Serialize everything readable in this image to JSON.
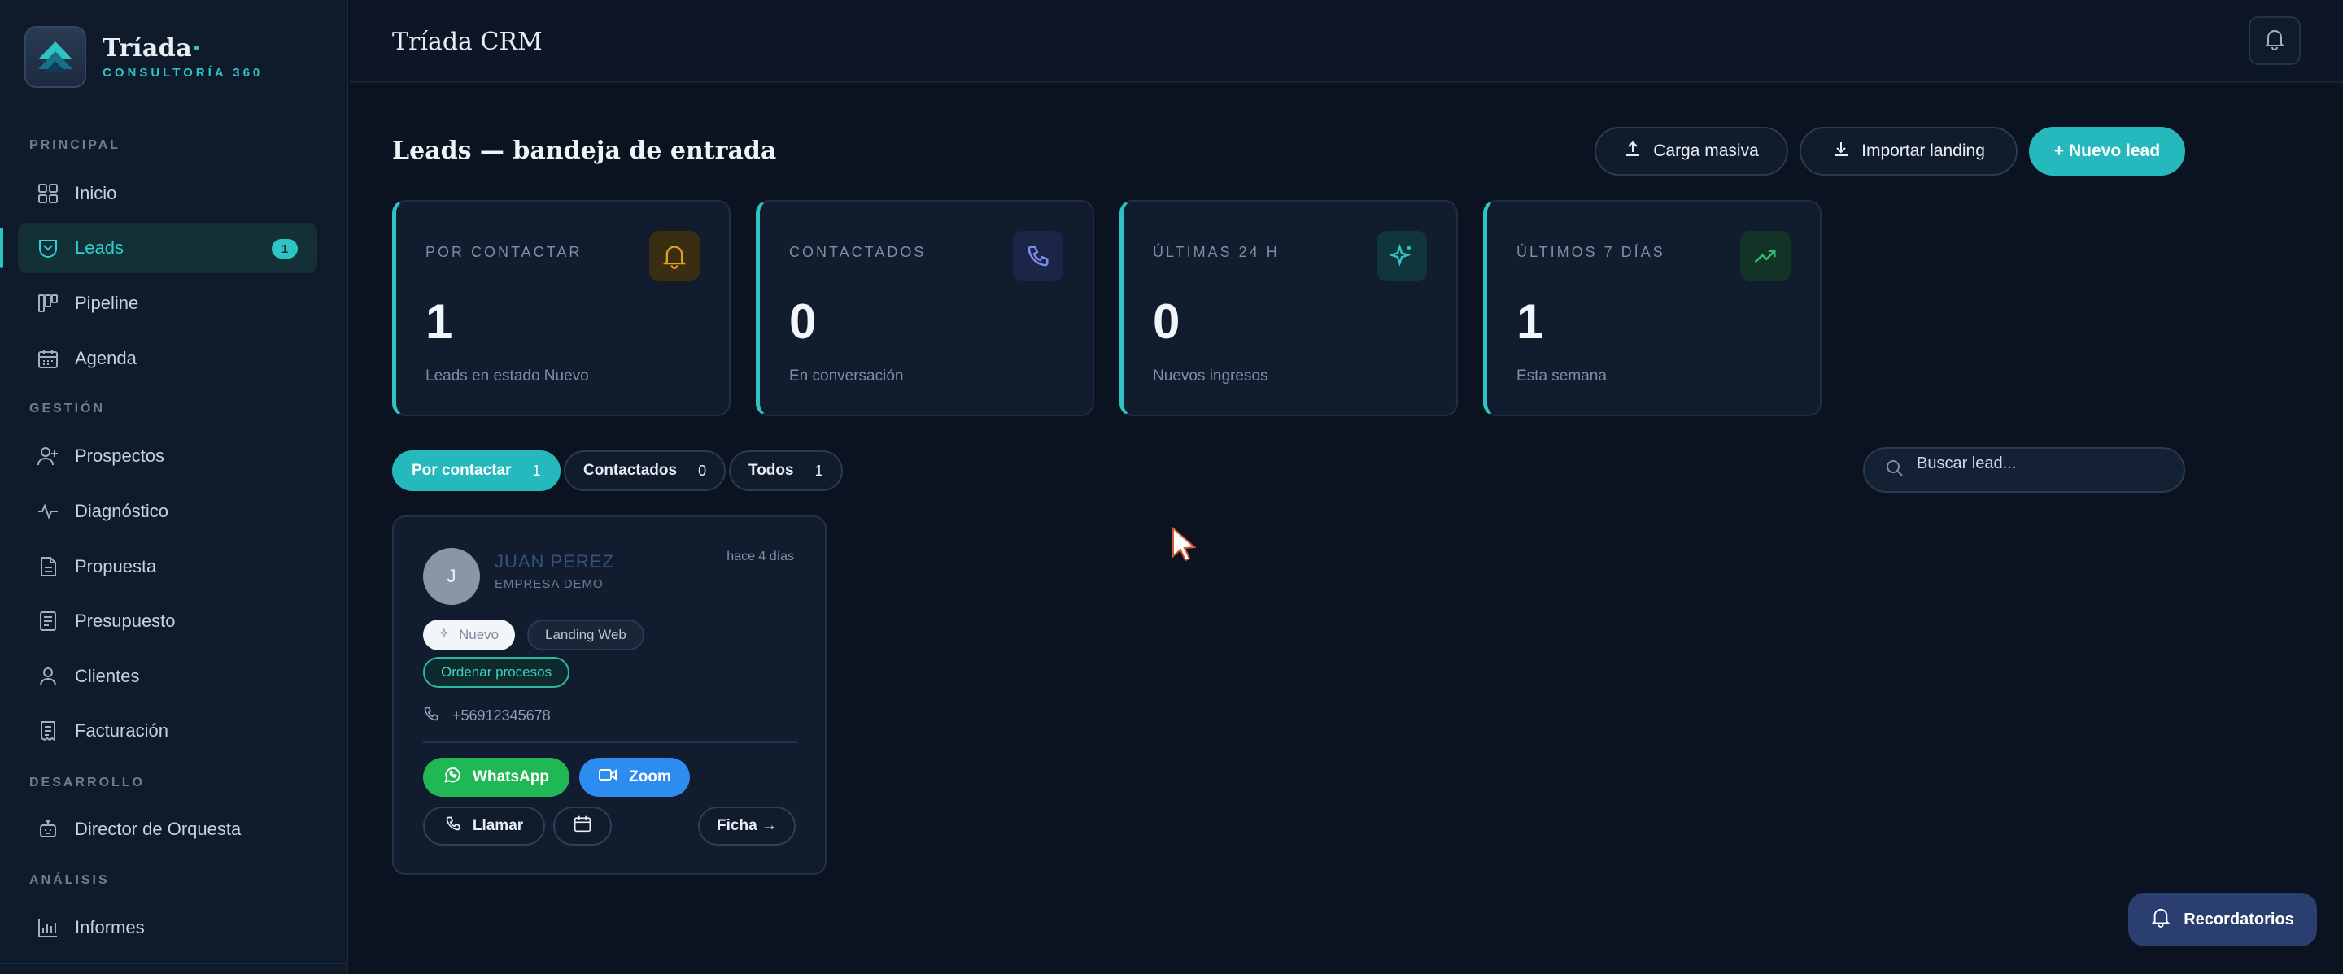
{
  "brand": {
    "name": "Tríada",
    "subtitle": "CONSULTORÍA 360"
  },
  "sidebar": {
    "sections": [
      {
        "label": "PRINCIPAL"
      },
      {
        "label": "GESTIÓN"
      },
      {
        "label": "DESARROLLO"
      },
      {
        "label": "ANÁLISIS"
      }
    ],
    "items": [
      {
        "label": "Inicio",
        "icon": "dashboard-icon"
      },
      {
        "label": "Leads",
        "icon": "inbox-icon",
        "badge": "1",
        "active": true
      },
      {
        "label": "Pipeline",
        "icon": "kanban-icon"
      },
      {
        "label": "Agenda",
        "icon": "calendar-icon"
      },
      {
        "label": "Prospectos",
        "icon": "user-plus-icon"
      },
      {
        "label": "Diagnóstico",
        "icon": "activity-icon"
      },
      {
        "label": "Propuesta",
        "icon": "document-icon"
      },
      {
        "label": "Presupuesto",
        "icon": "spreadsheet-icon"
      },
      {
        "label": "Clientes",
        "icon": "user-icon"
      },
      {
        "label": "Facturación",
        "icon": "receipt-icon"
      },
      {
        "label": "Director  de  Orquesta",
        "icon": "robot-icon"
      },
      {
        "label": "Informes",
        "icon": "bar-chart-icon"
      }
    ]
  },
  "topbar": {
    "title": "Tríada CRM",
    "bell_icon": "bell-icon"
  },
  "page": {
    "title": "Leads — bandeja de entrada",
    "buttons": {
      "bulk": "Carga  masiva",
      "import": "Importar  landing",
      "new": "+ Nuevo  lead"
    }
  },
  "stats": [
    {
      "label": "POR CONTACTAR",
      "value": "1",
      "sub": "Leads  en  estado  Nuevo",
      "icon": "bell-icon",
      "icon_color": "#e0a21c"
    },
    {
      "label": "CONTACTADOS",
      "value": "0",
      "sub": "En  conversación",
      "icon": "phone-icon",
      "icon_color": "#7b8cf0"
    },
    {
      "label": "ÚLTIMAS 24 H",
      "value": "0",
      "sub": "Nuevos  ingresos",
      "icon": "sparkle-icon",
      "icon_color": "#2fc4c4"
    },
    {
      "label": "ÚLTIMOS 7 DÍAS",
      "value": "1",
      "sub": "Esta  semana",
      "icon": "trending-up-icon",
      "icon_color": "#2fbf71"
    }
  ],
  "filters": [
    {
      "label": "Por  contactar",
      "count": "1",
      "active": true
    },
    {
      "label": "Contactados",
      "count": "0"
    },
    {
      "label": "Todos",
      "count": "1"
    }
  ],
  "search": {
    "placeholder": "Buscar lead..."
  },
  "lead": {
    "initial": "J",
    "name": "JUAN PEREZ",
    "company": "EMPRESA DEMO",
    "time": "hace  4  días",
    "status_tag": "Nuevo",
    "source_tag": "Landing  Web",
    "interest_tag": "Ordenar  procesos",
    "phone": "+56912345678",
    "actions": {
      "whatsapp": "WhatsApp",
      "zoom": "Zoom",
      "call": "Llamar",
      "file": "Ficha  →"
    }
  },
  "reminders": {
    "label": "Recordatorios"
  },
  "colors": {
    "accent": "#25b9bd",
    "background": "#0b1220",
    "sidebar": "#0f1a2b",
    "whatsapp": "#1fb855",
    "zoom": "#2d8cf0"
  }
}
